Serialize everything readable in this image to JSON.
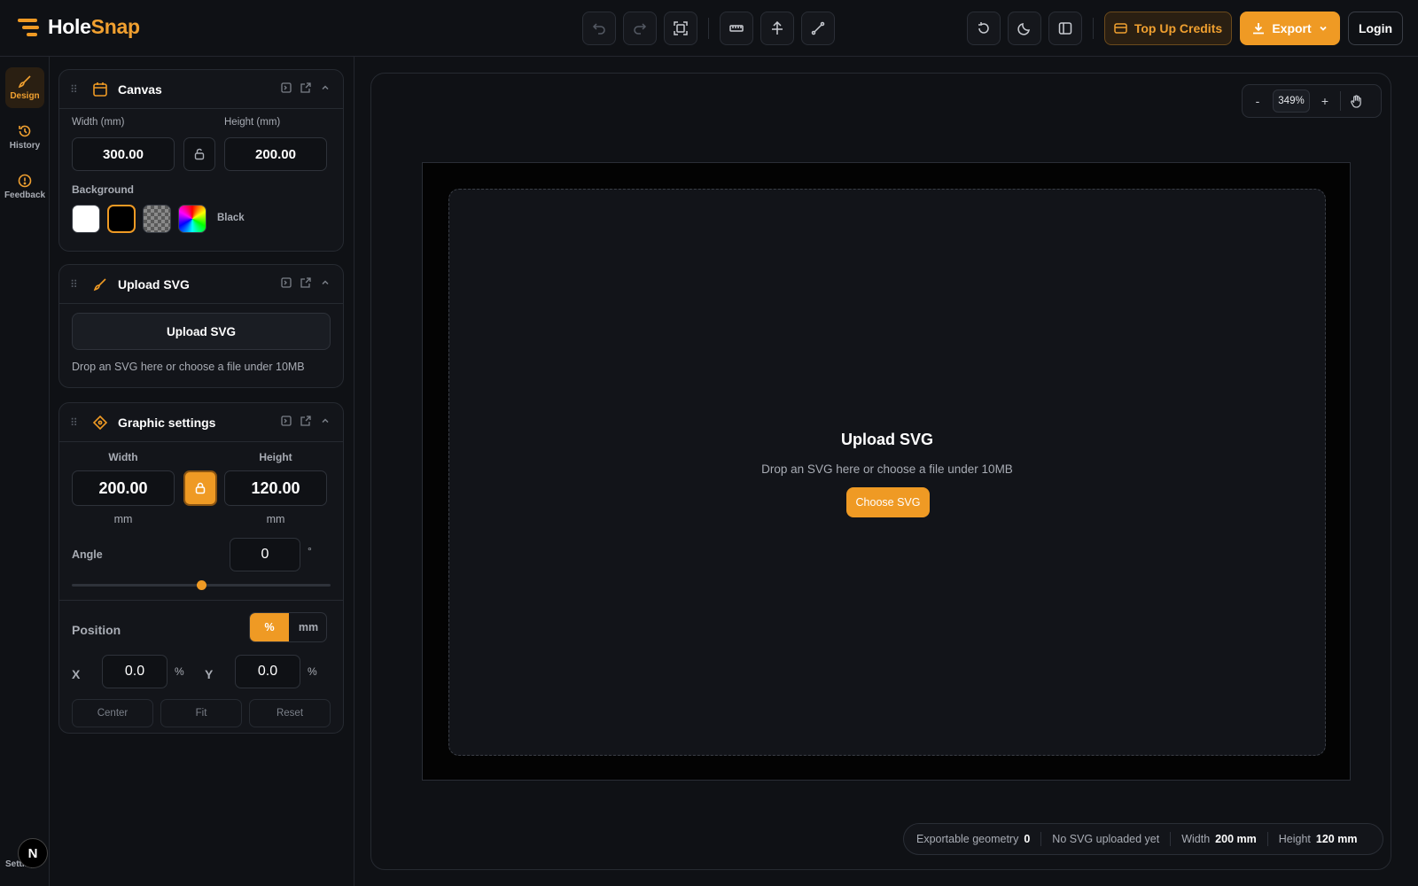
{
  "app": {
    "name_part1": "Hole",
    "name_part2": "Snap"
  },
  "colors": {
    "accent": "#ef9a24",
    "bg": "#0f1115",
    "panel": "#13151a"
  },
  "toolbar": {
    "icons": [
      "undo-icon",
      "redo-icon",
      "fit-screen-icon",
      "ruler-icon",
      "align-icon",
      "path-icon"
    ],
    "right_icons": [
      "reset-icon",
      "theme-moon-icon",
      "panel-toggle-icon"
    ],
    "top_up_label": "Top Up Credits",
    "export_label": "Export",
    "login_label": "Login"
  },
  "rail": {
    "items": [
      {
        "label": "Design",
        "icon": "brush-icon",
        "active": true
      },
      {
        "label": "History",
        "icon": "history-icon",
        "active": false
      },
      {
        "label": "Feedback",
        "icon": "feedback-icon",
        "active": false
      }
    ],
    "avatar_letter": "N",
    "footer_label": "Settings"
  },
  "canvas_card": {
    "title": "Canvas",
    "width_label": "Width (mm)",
    "height_label": "Height (mm)",
    "width_value": "300.00",
    "height_value": "200.00",
    "background_label": "Background",
    "background_selected": "Black",
    "swatches": [
      "white",
      "black",
      "transparent",
      "custom"
    ]
  },
  "upload_card": {
    "title": "Upload SVG",
    "button_label": "Upload SVG",
    "hint": "Drop an SVG here or choose a file under 10MB"
  },
  "graphic_card": {
    "title": "Graphic settings",
    "width_label": "Width",
    "height_label": "Height",
    "width_value": "200.00",
    "height_value": "120.00",
    "unit": "mm",
    "angle_label": "Angle",
    "angle_value": "0",
    "angle_unit": "°",
    "angle_slider_fraction": 0.5,
    "position_label": "Position",
    "position_units": [
      "%",
      "mm"
    ],
    "position_unit_selected": "%",
    "x_label": "X",
    "y_label": "Y",
    "x_value": "0.0",
    "y_value": "0.0",
    "pos_unit": "%",
    "buttons": [
      "Center",
      "Fit",
      "Reset"
    ]
  },
  "workspace": {
    "zoom_minus": "-",
    "zoom_value": "349%",
    "zoom_plus": "+",
    "drop_title": "Upload SVG",
    "drop_hint": "Drop an SVG here or choose a file under 10MB",
    "choose_label": "Choose SVG"
  },
  "status": {
    "geometry_label": "Exportable geometry",
    "geometry_value": "0",
    "svg_status": "No SVG uploaded yet",
    "width_label": "Width",
    "width_value": "200 mm",
    "height_label": "Height",
    "height_value": "120 mm"
  }
}
